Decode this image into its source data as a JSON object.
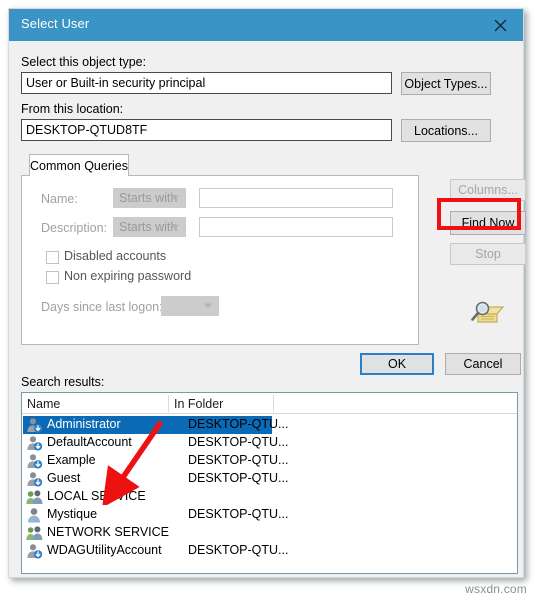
{
  "window": {
    "title": "Select User",
    "close_icon": "close-icon"
  },
  "object_type": {
    "label": "Select this object type:",
    "value": "User or Built-in security principal",
    "button": "Object Types..."
  },
  "location": {
    "label": "From this location:",
    "value": "DESKTOP-QTUD8TF",
    "button": "Locations..."
  },
  "tabs": [
    {
      "label": "Common Queries",
      "active": true
    }
  ],
  "query_panel": {
    "name": {
      "label": "Name:",
      "operator": "Starts with",
      "value": ""
    },
    "description": {
      "label": "Description:",
      "operator": "Starts with",
      "value": ""
    },
    "disabled_accounts": {
      "label": "Disabled accounts",
      "checked": false
    },
    "non_expiring_password": {
      "label": "Non expiring password",
      "checked": false
    },
    "days_since_last_logon": {
      "label": "Days since last logon:",
      "value": ""
    }
  },
  "side_buttons": {
    "columns": {
      "label": "Columns...",
      "enabled": false
    },
    "find_now": {
      "label": "Find Now",
      "enabled": true,
      "highlighted": true
    },
    "stop": {
      "label": "Stop",
      "enabled": false
    },
    "icon": "search-folder-icon"
  },
  "dialog_buttons": {
    "ok": {
      "label": "OK",
      "default": true
    },
    "cancel": {
      "label": "Cancel",
      "default": false
    }
  },
  "search_results": {
    "label": "Search results:",
    "columns": [
      "Name",
      "In Folder"
    ],
    "rows": [
      {
        "name": "Administrator",
        "folder": "DESKTOP-QTU...",
        "icon": "user-icon",
        "selected": true
      },
      {
        "name": "DefaultAccount",
        "folder": "DESKTOP-QTU...",
        "icon": "user-icon",
        "selected": false
      },
      {
        "name": "Example",
        "folder": "DESKTOP-QTU...",
        "icon": "user-icon",
        "selected": false
      },
      {
        "name": "Guest",
        "folder": "DESKTOP-QTU...",
        "icon": "user-icon",
        "selected": false
      },
      {
        "name": "LOCAL SERVICE",
        "folder": "",
        "icon": "group-icon",
        "selected": false
      },
      {
        "name": "Mystique",
        "folder": "DESKTOP-QTU...",
        "icon": "person-icon",
        "selected": false
      },
      {
        "name": "NETWORK SERVICE",
        "folder": "",
        "icon": "group-icon",
        "selected": false
      },
      {
        "name": "WDAGUtilityAccount",
        "folder": "DESKTOP-QTU...",
        "icon": "user-icon",
        "selected": false
      }
    ]
  },
  "annotations": {
    "highlight_box_target": "Find Now",
    "arrow_target": "LOCAL SERVICE",
    "color": "#ee1111"
  },
  "watermark": "wsxdn.com",
  "colors": {
    "titlebar": "#3a94c5",
    "selection": "#0a6ab5",
    "dialog_bg": "#f0f0f0",
    "accent_border": "#2a7fc9"
  }
}
